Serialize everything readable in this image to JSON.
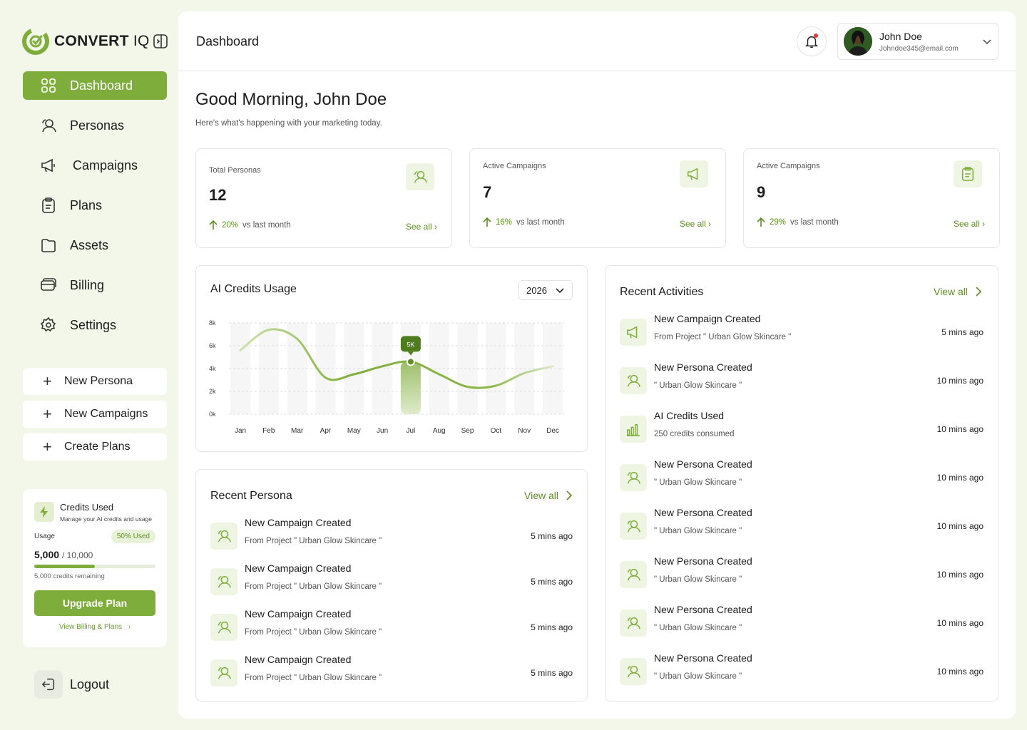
{
  "brand": {
    "name": "CONVERT",
    "suffix": "IQ"
  },
  "sidebar": {
    "nav": [
      {
        "label": "Dashboard",
        "icon": "grid-icon"
      },
      {
        "label": "Personas",
        "icon": "persona-icon"
      },
      {
        "label": "Campaigns",
        "icon": "megaphone-icon"
      },
      {
        "label": "Plans",
        "icon": "clipboard-icon"
      },
      {
        "label": "Assets",
        "icon": "folder-icon"
      },
      {
        "label": "Billing",
        "icon": "card-icon"
      },
      {
        "label": "Settings",
        "icon": "gear-icon"
      }
    ],
    "quick_actions": [
      "New Persona",
      "New Campaigns",
      "Create Plans"
    ],
    "credits": {
      "title": "Credits Used",
      "subtitle": "Manage your AI credits and usage",
      "usage_label": "Usage",
      "usage_badge": "50% Used",
      "used": "5,000",
      "total": "/ 10,000",
      "usage_fraction": 0.5,
      "remaining": "5,000 credits remaining",
      "upgrade_label": "Upgrade Plan",
      "billing_link": "View Billing & Plans"
    },
    "logout_label": "Logout"
  },
  "header": {
    "title": "Dashboard",
    "user": {
      "name": "John Doe",
      "email": "Johndoe345@email.com"
    }
  },
  "greeting": {
    "title": "Good Morning, John Doe",
    "subtitle": "Here's what's happening with your marketing today."
  },
  "stats": [
    {
      "label": "Total Personas",
      "value": "12",
      "pct": "20%",
      "trend": "vs last month",
      "link": "See all ›",
      "icon": "persona-icon"
    },
    {
      "label": "Active Campaigns",
      "value": "7",
      "pct": "16%",
      "trend": "vs last month",
      "link": "See all ›",
      "icon": "megaphone-icon"
    },
    {
      "label": "Active Campaigns",
      "value": "9",
      "pct": "29%",
      "trend": "vs last month",
      "link": "See all ›",
      "icon": "clipboard-icon"
    }
  ],
  "credits_chart": {
    "title": "AI  Credits Usage",
    "year": "2026",
    "highlight_label": "5K"
  },
  "chart_data": {
    "type": "line",
    "title": "AI  Credits Usage",
    "categories": [
      "Jan",
      "Feb",
      "Mar",
      "Apr",
      "May",
      "Jun",
      "Jul",
      "Aug",
      "Sep",
      "Oct",
      "Nov",
      "Dec"
    ],
    "y_ticks": [
      "8k",
      "6k",
      "4k",
      "2k",
      "0k"
    ],
    "ylim": [
      0,
      8000
    ],
    "values": [
      5600,
      7400,
      6600,
      3200,
      3500,
      4200,
      4600,
      3500,
      2400,
      2500,
      3600,
      4200
    ],
    "highlight": {
      "category": "Jul",
      "label": "5K"
    },
    "grid": true
  },
  "recent_persona": {
    "title": "Recent Persona",
    "view_all": "View all",
    "items": [
      {
        "title": "New Campaign Created",
        "sub": "From Project \" Urban Glow Skincare \"",
        "time": "5 mins ago"
      },
      {
        "title": "New Campaign Created",
        "sub": "From Project \" Urban Glow Skincare \"",
        "time": "5 mins ago"
      },
      {
        "title": "New Campaign Created",
        "sub": "From Project \" Urban Glow Skincare \"",
        "time": "5 mins ago"
      },
      {
        "title": "New Campaign Created",
        "sub": "From Project \" Urban Glow Skincare \"",
        "time": "5 mins ago"
      }
    ]
  },
  "recent_activities": {
    "title": "Recent Activities",
    "view_all": "View all",
    "items": [
      {
        "title": "New Campaign Created",
        "sub": "From Project \" Urban Glow Skincare \"",
        "time": "5 mins ago",
        "icon": "megaphone-icon"
      },
      {
        "title": "New Persona Created",
        "sub": "\" Urban Glow Skincare \"",
        "time": "10 mins ago",
        "icon": "persona-icon"
      },
      {
        "title": "AI Credits Used",
        "sub": "250 credits consumed",
        "time": "10 mins ago",
        "icon": "bar-chart-icon"
      },
      {
        "title": "New Persona Created",
        "sub": "\" Urban Glow Skincare \"",
        "time": "10 mins ago",
        "icon": "persona-icon"
      },
      {
        "title": "New Persona Created",
        "sub": "\" Urban Glow Skincare \"",
        "time": "10 mins ago",
        "icon": "persona-icon"
      },
      {
        "title": "New Persona Created",
        "sub": "\" Urban Glow Skincare \"",
        "time": "10 mins ago",
        "icon": "persona-icon"
      },
      {
        "title": "New Persona Created",
        "sub": "\" Urban Glow Skincare \"",
        "time": "10 mins ago",
        "icon": "persona-icon"
      },
      {
        "title": "New Persona Created",
        "sub": "\" Urban Glow Skincare \"",
        "time": "10 mins ago",
        "icon": "persona-icon"
      }
    ]
  },
  "colors": {
    "accent": "#7fad3c",
    "accent_text": "#5e8f22",
    "accent_soft": "#eef5e2",
    "page_bg": "#f3f7ea"
  }
}
